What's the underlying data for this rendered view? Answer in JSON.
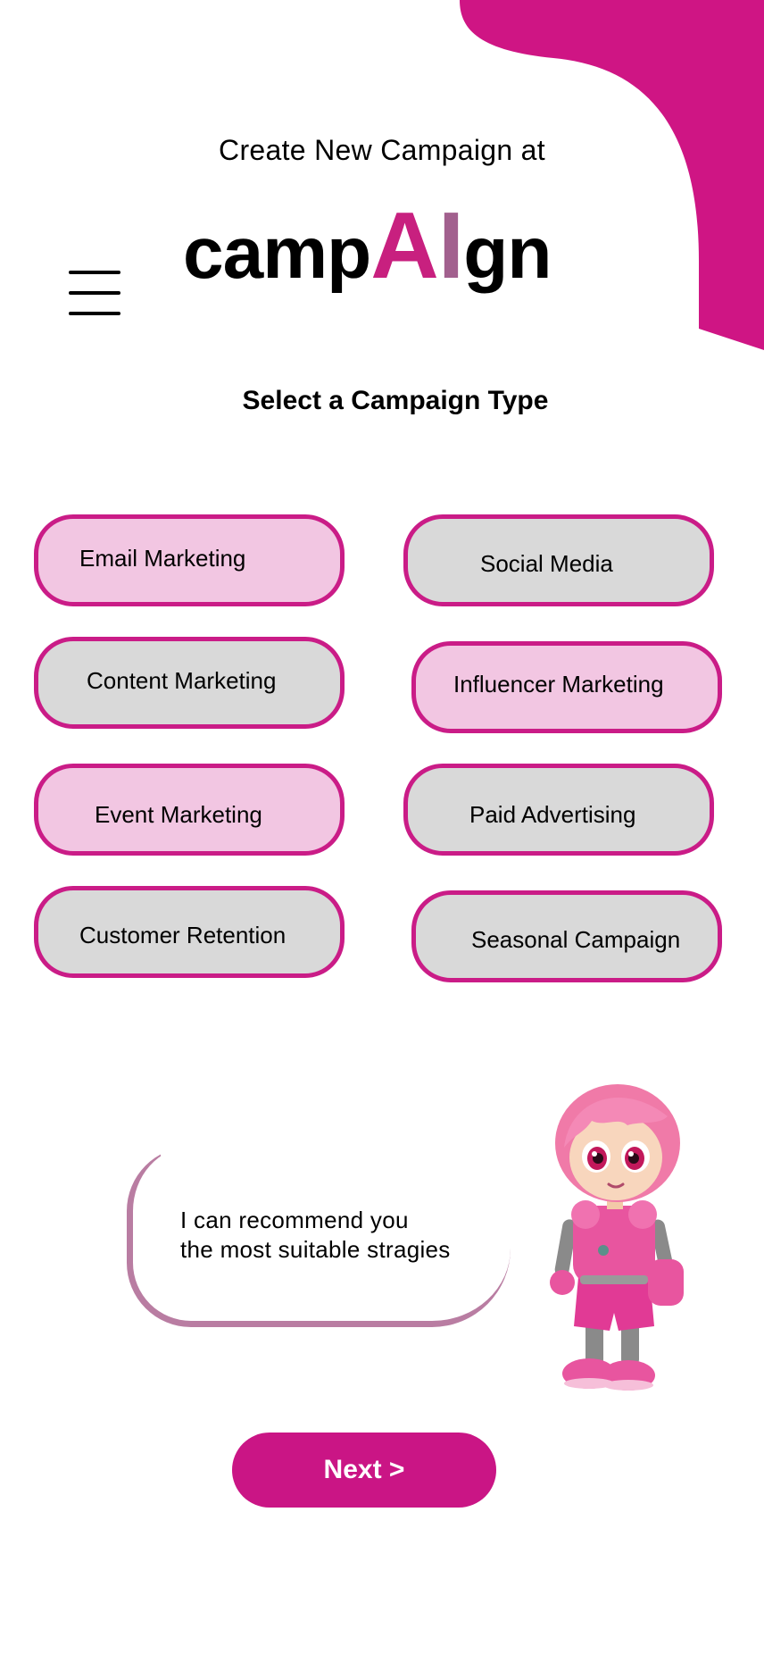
{
  "header": {
    "subtitle": "Create New Campaign at",
    "brand": {
      "part1": "camp",
      "ai_a": "A",
      "ai_i": "I",
      "part2": "gn"
    },
    "menu_icon": "hamburger-menu-icon"
  },
  "section_title": "Select a Campaign Type",
  "campaign_types": [
    {
      "label": "Email Marketing",
      "style": "pink"
    },
    {
      "label": "Social Media",
      "style": "grey"
    },
    {
      "label": "Content Marketing",
      "style": "grey"
    },
    {
      "label": "Influencer Marketing",
      "style": "pink"
    },
    {
      "label": "Event Marketing",
      "style": "pink"
    },
    {
      "label": "Paid Advertising",
      "style": "grey"
    },
    {
      "label": "Customer Retention",
      "style": "grey"
    },
    {
      "label": "Seasonal Campaign",
      "style": "grey"
    }
  ],
  "assistant": {
    "line1": "I can recommend you",
    "line2": "the most suitable stragies",
    "mascot_icon": "robot-mascot-icon"
  },
  "next_button": "Next >",
  "colors": {
    "brand": "#ca1585",
    "brand_gradient_end": "#a2608e",
    "pill_selected": "#f2c6e2",
    "pill_unselected": "#d9d9d9",
    "bubble_border": "#b97da2"
  }
}
